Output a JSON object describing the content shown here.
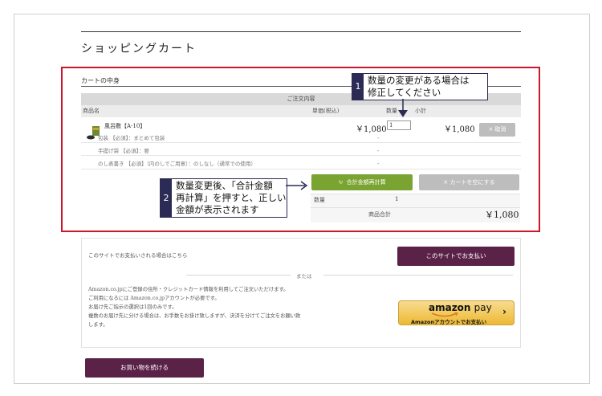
{
  "page": {
    "title": "ショッピングカート"
  },
  "cart": {
    "section_label": "カートの中身",
    "order_header": "ご注文内容",
    "columns": {
      "name": "商品名",
      "price": "単価(税込)",
      "qty": "数量",
      "subtotal": "小計"
    },
    "item": {
      "name": "風呂敷【A-10】",
      "options": [
        "包装 【必須】：まとめて包装",
        "手提げ袋 【必須】：要",
        "のし表書き 【必須】（内のしでご用意）：のしなし（通常での使用）"
      ],
      "price": "￥1,080",
      "option_dash": "-",
      "qty": "1",
      "subtotal": "￥1,080",
      "cancel_label": "× 取消"
    },
    "recalc_label": "合計金額再計算",
    "empty_label": "× カートを空にする",
    "summary": {
      "qty_label": "数量",
      "qty_value": "1",
      "total_label": "商品合計",
      "total_value": "￥1,080"
    }
  },
  "callouts": {
    "c1": {
      "num": "1",
      "line1": "数量の変更がある場合は",
      "line2": "修正してください"
    },
    "c2": {
      "num": "2",
      "line1": "数量変更後、「合計金額",
      "line2": "再計算」を押すと、正しい",
      "line3": "金額が表示されます"
    }
  },
  "payment": {
    "site_text": "このサイトでお支払いされる場合はこちら",
    "site_button": "このサイトでお支払い",
    "or_text": "または",
    "amazon_lines": [
      "Amazon.co.jpにご登録の住所・クレジットカード情報を利用してご注文いただけます。",
      "ご利用になるには Amazon.co.jpアカウントが必要です。",
      "お届け先ご指示の選択は1回のみです。",
      "複数のお届け先に分ける場合は、お手数をお掛け致しますが、決済を分けてご注文をお願い致",
      "します。"
    ],
    "amazon_logo_a": "amazon",
    "amazon_logo_b": "pay",
    "amazon_sub": "Amazonアカウントでお支払い",
    "amazon_chevron": "›"
  },
  "continue_label": "お買い物を続ける",
  "colors": {
    "red_border": "#c9182b",
    "navy": "#2b2b55",
    "green": "#7aa431",
    "plum": "#5b2248"
  }
}
